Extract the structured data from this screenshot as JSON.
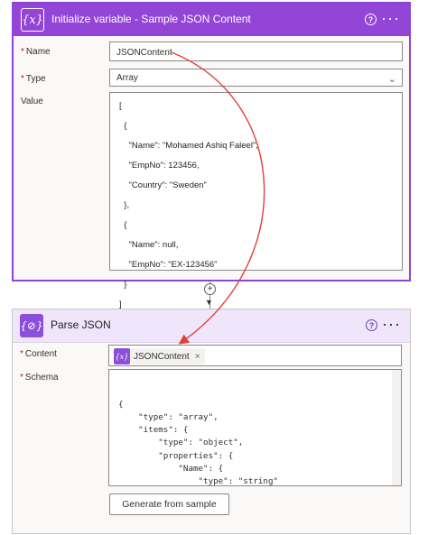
{
  "card1": {
    "title": "Initialize variable - Sample JSON Content",
    "icon_glyph": "{x}",
    "help_glyph": "?",
    "more_glyph": "···",
    "name_label": "Name",
    "name_value": "JSONContent",
    "type_label": "Type",
    "type_value": "Array",
    "value_label": "Value",
    "value_lines": "[\n  {\n    \"Name\": \"Mohamed Ashiq Faleel\",\n    \"EmpNo\": 123456,\n    \"Country\": \"Sweden\"\n  },\n  {\n    \"Name\": null,\n    \"EmpNo\": \"EX-123456\"\n  }\n]"
  },
  "connector": {
    "add_glyph": "+",
    "arrow_glyph": "▼"
  },
  "card2": {
    "title": "Parse JSON",
    "icon_glyph": "{⊘}",
    "help_glyph": "?",
    "more_glyph": "···",
    "content_label": "Content",
    "content_token": "JSONContent",
    "token_icon_glyph": "{x}",
    "token_remove": "×",
    "schema_label": "Schema",
    "schema_text": "{\n    \"type\": \"array\",\n    \"items\": {\n        \"type\": \"object\",\n        \"properties\": {\n            \"Name\": {\n                \"type\": \"string\"\n            },\n            \"EmpNo\": {\n                \"type\": \"integer\"",
    "generate_button": "Generate from sample"
  },
  "colors": {
    "accent": "#9245d6",
    "arrow": "#e0403a"
  }
}
